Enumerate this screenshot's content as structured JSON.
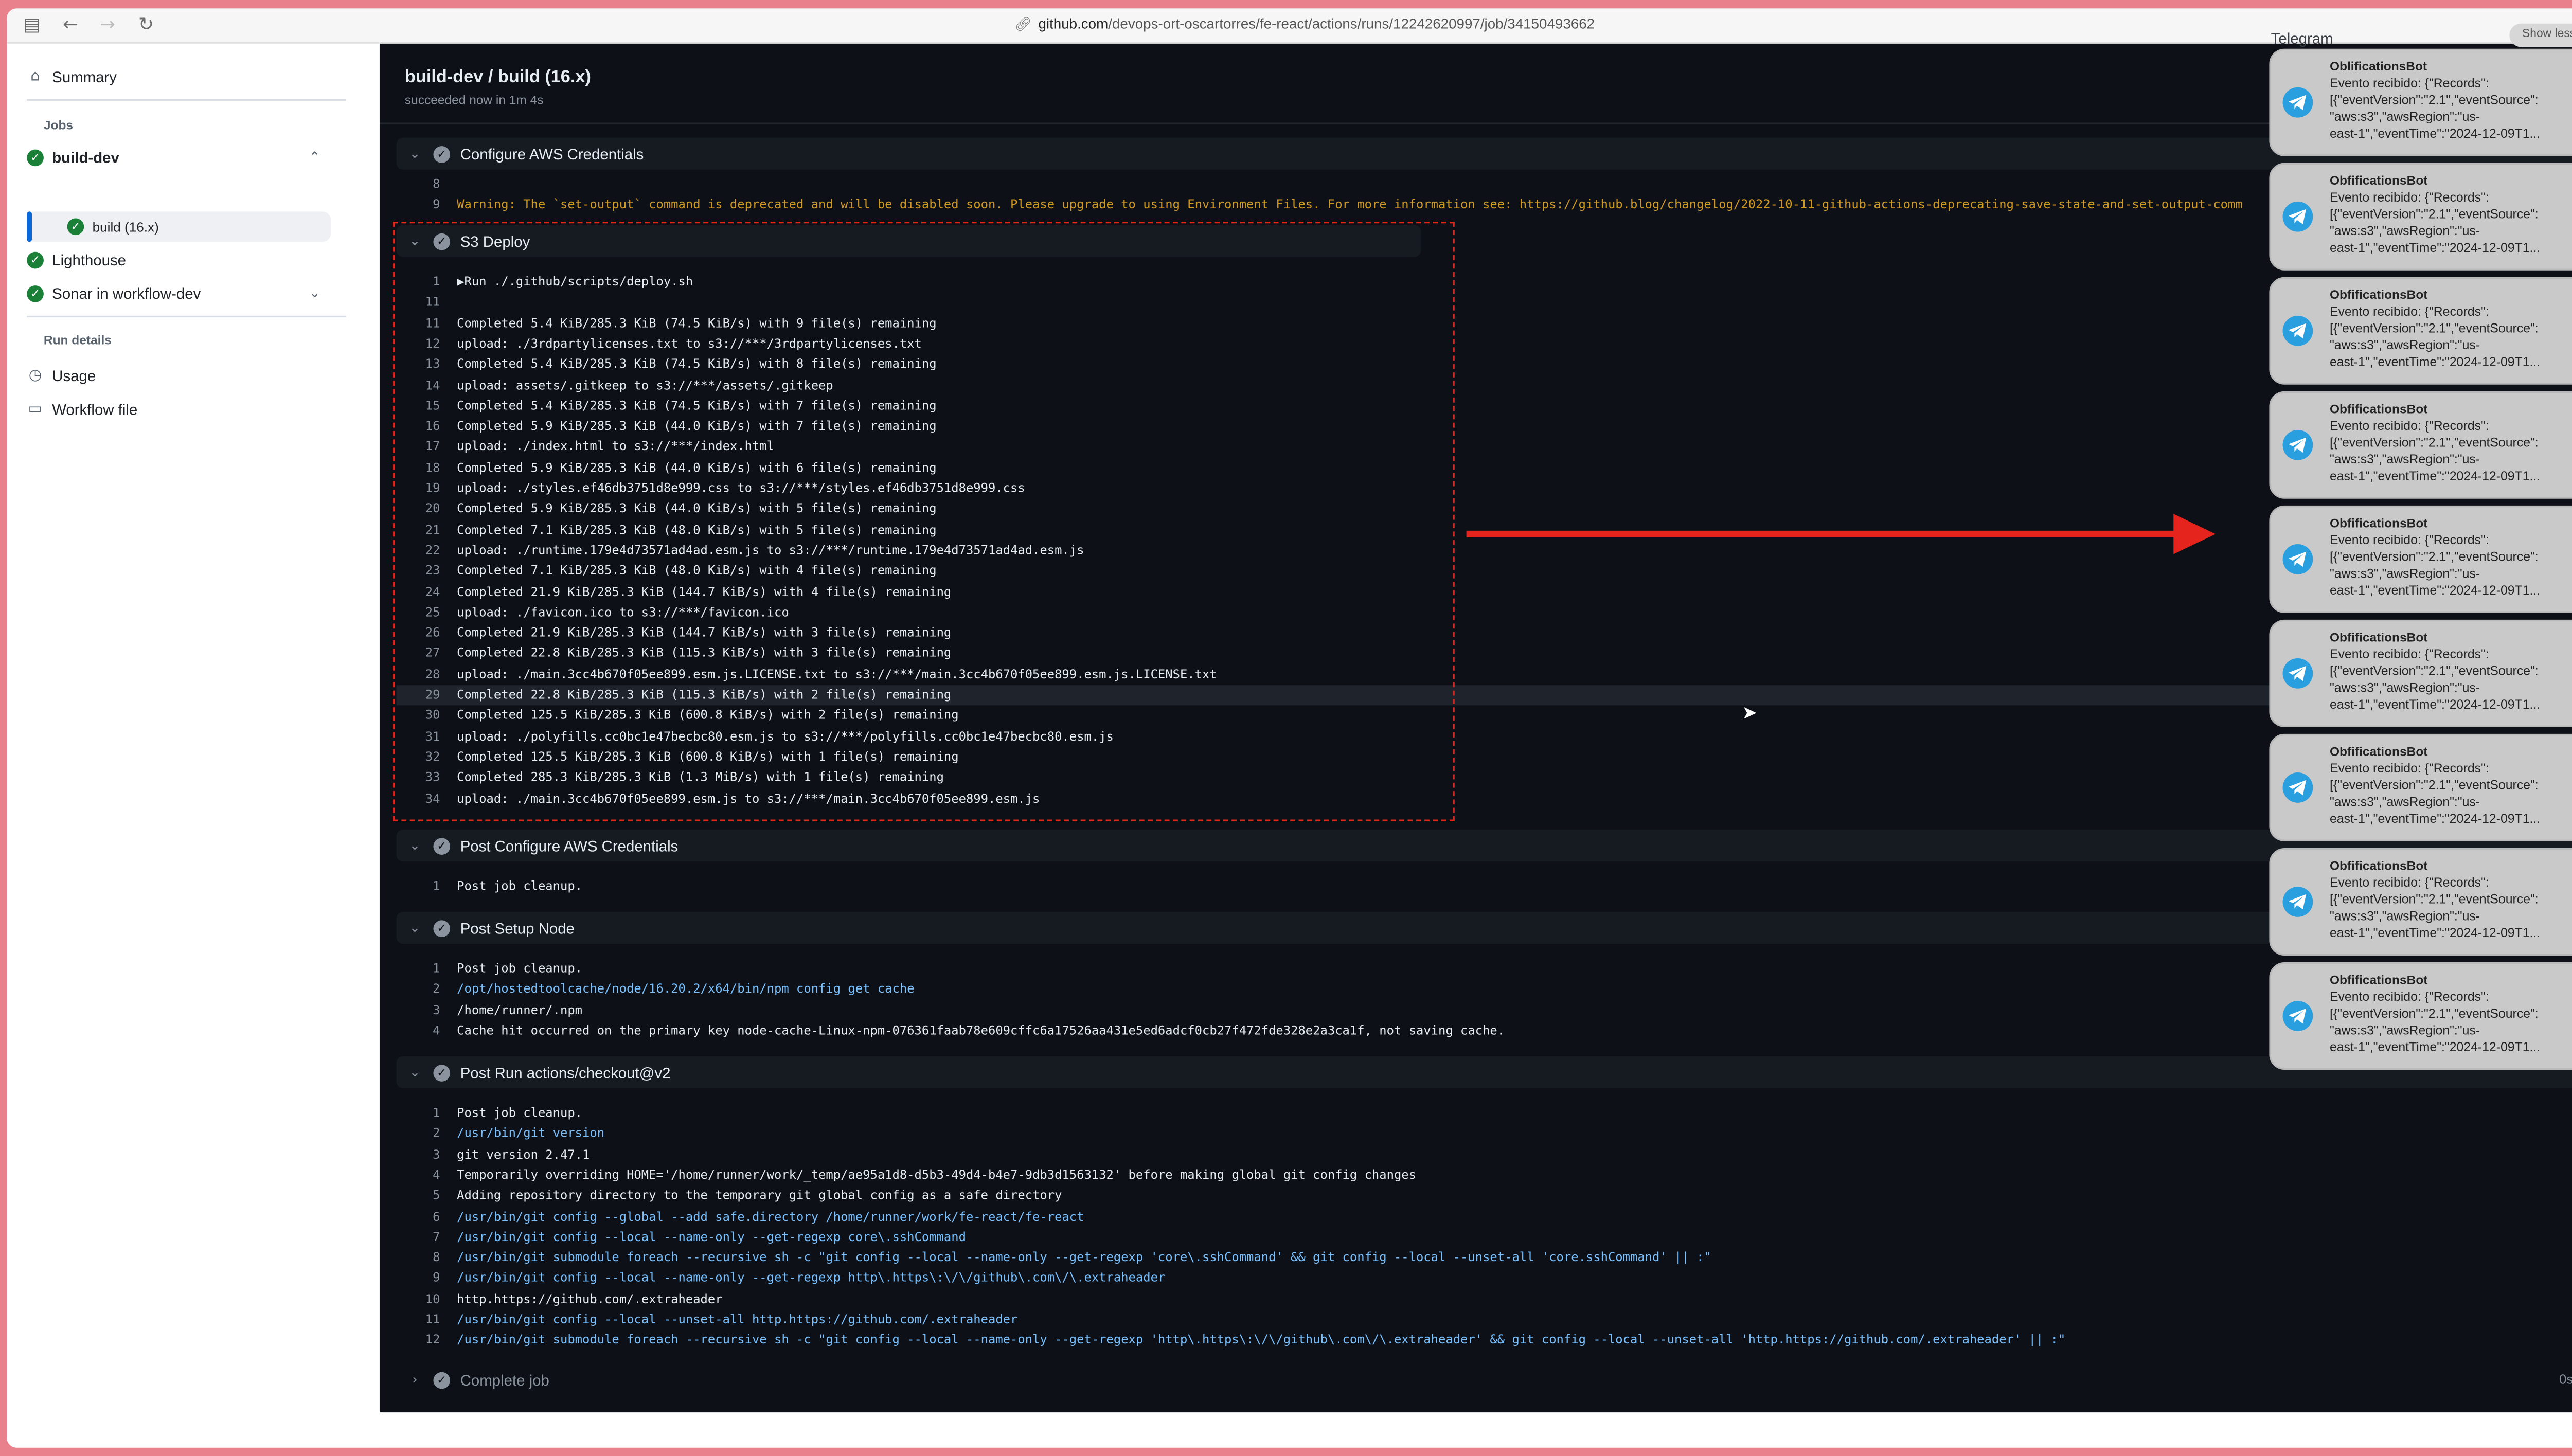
{
  "browser": {
    "url_domain": "github.com",
    "url_path": "/devops-ort-oscartorres/fe-react/actions/runs/12242620997/job/34150493662",
    "icons": [
      "sidebar-toggle-icon",
      "back-icon",
      "forward-icon",
      "reload-icon",
      "link-icon"
    ]
  },
  "sidebar": {
    "summary": "Summary",
    "jobs_heading": "Jobs",
    "jobs": [
      {
        "label": "build-dev"
      },
      {
        "label": "build (16.x)"
      },
      {
        "label": "Lighthouse"
      },
      {
        "label": "Sonar in workflow-dev"
      }
    ],
    "run_details_heading": "Run details",
    "usage": "Usage",
    "workflow_file": "Workflow file"
  },
  "header": {
    "title": "build-dev / build (16.x)",
    "subtitle": "succeeded now in 1m 4s"
  },
  "steps": {
    "configure_aws": "Configure AWS Credentials",
    "s3_deploy": "S3 Deploy",
    "post_configure_aws": "Post Configure AWS Credentials",
    "post_setup_node": "Post Setup Node",
    "post_checkout": "Post Run actions/checkout@v2",
    "complete_job": "Complete job",
    "complete_job_duration": "0s"
  },
  "logs": {
    "configure_aws": [
      {
        "n": "8",
        "t": ""
      },
      {
        "n": "9",
        "t": "Warning: The `set-output` command is deprecated and will be disabled soon. Please upgrade to using Environment Files. For more information see: https://github.blog/changelog/2022-10-11-github-actions-deprecating-save-state-and-set-output-comm"
      }
    ],
    "s3_deploy": [
      {
        "n": "1",
        "t": "▶Run ./.github/scripts/deploy.sh"
      },
      {
        "n": "11",
        "t": ""
      },
      {
        "n": "11",
        "t": "Completed 5.4 KiB/285.3 KiB (74.5 KiB/s) with 9 file(s) remaining"
      },
      {
        "n": "12",
        "t": "upload: ./3rdpartylicenses.txt to s3://***/3rdpartylicenses.txt"
      },
      {
        "n": "13",
        "t": "Completed 5.4 KiB/285.3 KiB (74.5 KiB/s) with 8 file(s) remaining"
      },
      {
        "n": "14",
        "t": "upload: assets/.gitkeep to s3://***/assets/.gitkeep"
      },
      {
        "n": "15",
        "t": "Completed 5.4 KiB/285.3 KiB (74.5 KiB/s) with 7 file(s) remaining"
      },
      {
        "n": "16",
        "t": "Completed 5.9 KiB/285.3 KiB (44.0 KiB/s) with 7 file(s) remaining"
      },
      {
        "n": "17",
        "t": "upload: ./index.html to s3://***/index.html"
      },
      {
        "n": "18",
        "t": "Completed 5.9 KiB/285.3 KiB (44.0 KiB/s) with 6 file(s) remaining"
      },
      {
        "n": "19",
        "t": "upload: ./styles.ef46db3751d8e999.css to s3://***/styles.ef46db3751d8e999.css"
      },
      {
        "n": "20",
        "t": "Completed 5.9 KiB/285.3 KiB (44.0 KiB/s) with 5 file(s) remaining"
      },
      {
        "n": "21",
        "t": "Completed 7.1 KiB/285.3 KiB (48.0 KiB/s) with 5 file(s) remaining"
      },
      {
        "n": "22",
        "t": "upload: ./runtime.179e4d73571ad4ad.esm.js to s3://***/runtime.179e4d73571ad4ad.esm.js"
      },
      {
        "n": "23",
        "t": "Completed 7.1 KiB/285.3 KiB (48.0 KiB/s) with 4 file(s) remaining"
      },
      {
        "n": "24",
        "t": "Completed 21.9 KiB/285.3 KiB (144.7 KiB/s) with 4 file(s) remaining"
      },
      {
        "n": "25",
        "t": "upload: ./favicon.ico to s3://***/favicon.ico"
      },
      {
        "n": "26",
        "t": "Completed 21.9 KiB/285.3 KiB (144.7 KiB/s) with 3 file(s) remaining"
      },
      {
        "n": "27",
        "t": "Completed 22.8 KiB/285.3 KiB (115.3 KiB/s) with 3 file(s) remaining"
      },
      {
        "n": "28",
        "t": "upload: ./main.3cc4b670f05ee899.esm.js.LICENSE.txt to s3://***/main.3cc4b670f05ee899.esm.js.LICENSE.txt"
      },
      {
        "n": "29",
        "t": "Completed 22.8 KiB/285.3 KiB (115.3 KiB/s) with 2 file(s) remaining"
      },
      {
        "n": "30",
        "t": "Completed 125.5 KiB/285.3 KiB (600.8 KiB/s) with 2 file(s) remaining"
      },
      {
        "n": "31",
        "t": "upload: ./polyfills.cc0bc1e47becbc80.esm.js to s3://***/polyfills.cc0bc1e47becbc80.esm.js"
      },
      {
        "n": "32",
        "t": "Completed 125.5 KiB/285.3 KiB (600.8 KiB/s) with 1 file(s) remaining"
      },
      {
        "n": "33",
        "t": "Completed 285.3 KiB/285.3 KiB (1.3 MiB/s) with 1 file(s) remaining"
      },
      {
        "n": "34",
        "t": "upload: ./main.3cc4b670f05ee899.esm.js to s3://***/main.3cc4b670f05ee899.esm.js"
      }
    ],
    "post_configure_aws": [
      {
        "n": "1",
        "t": "Post job cleanup."
      }
    ],
    "post_setup_node": [
      {
        "n": "1",
        "t": "Post job cleanup."
      },
      {
        "n": "2",
        "t": "/opt/hostedtoolcache/node/16.20.2/x64/bin/npm config get cache"
      },
      {
        "n": "3",
        "t": "/home/runner/.npm"
      },
      {
        "n": "4",
        "t": "Cache hit occurred on the primary key node-cache-Linux-npm-076361faab78e609cffc6a17526aa431e5ed6adcf0cb27f472fde328e2a3ca1f, not saving cache."
      }
    ],
    "post_checkout": [
      {
        "n": "1",
        "t": "Post job cleanup."
      },
      {
        "n": "2",
        "t": "/usr/bin/git version"
      },
      {
        "n": "3",
        "t": "git version 2.47.1"
      },
      {
        "n": "4",
        "t": "Temporarily overriding HOME='/home/runner/work/_temp/ae95a1d8-d5b3-49d4-b4e7-9db3d1563132' before making global git config changes"
      },
      {
        "n": "5",
        "t": "Adding repository directory to the temporary git global config as a safe directory"
      },
      {
        "n": "6",
        "t": "/usr/bin/git config --global --add safe.directory /home/runner/work/fe-react/fe-react"
      },
      {
        "n": "7",
        "t": "/usr/bin/git config --local --name-only --get-regexp core\\.sshCommand"
      },
      {
        "n": "8",
        "t": "/usr/bin/git submodule foreach --recursive sh -c \"git config --local --name-only --get-regexp 'core\\.sshCommand' && git config --local --unset-all 'core.sshCommand' || :\""
      },
      {
        "n": "9",
        "t": "/usr/bin/git config --local --name-only --get-regexp http\\.https\\:\\/\\/github\\.com\\/\\.extraheader"
      },
      {
        "n": "10",
        "t": "http.https://github.com/.extraheader"
      },
      {
        "n": "11",
        "t": "/usr/bin/git config --local --unset-all http.https://github.com/.extraheader"
      },
      {
        "n": "12",
        "t": "/usr/bin/git submodule foreach --recursive sh -c \"git config --local --name-only --get-regexp 'http\\.https\\:\\/\\/github\\.com\\/\\.extraheader' && git config --local --unset-all 'http.https://github.com/.extraheader' || :\""
      }
    ]
  },
  "notifications": {
    "app_title": "Telegram",
    "show_less": "Show less",
    "close": "×",
    "items": [
      {
        "sender": "OblificationsBot",
        "lines": [
          "Evento recibido: {\"Records\":",
          "[{\"eventVersion\":\"2.1\",\"eventSource\":",
          "\"aws:s3\",\"awsRegion\":\"us-",
          "east-1\",\"eventTime\":\"2024-12-09T1..."
        ],
        "avatar": "DO"
      },
      {
        "sender": "ObfificationsBot",
        "lines": [
          "Evento recibido: {\"Records\":",
          "[{\"eventVersion\":\"2.1\",\"eventSource\":",
          "\"aws:s3\",\"awsRegion\":\"us-",
          "east-1\",\"eventTime\":\"2024-12-09T1..."
        ],
        "avatar": "DO"
      },
      {
        "sender": "ObfificationsBot",
        "lines": [
          "Evento recibido: {\"Records\":",
          "[{\"eventVersion\":\"2.1\",\"eventSource\":",
          "\"aws:s3\",\"awsRegion\":\"us-",
          "east-1\",\"eventTime\":\"2024-12-09T1..."
        ],
        "avatar": "DO"
      },
      {
        "sender": "ObfificationsBot",
        "lines": [
          "Evento recibido: {\"Records\":",
          "[{\"eventVersion\":\"2.1\",\"eventSource\":",
          "\"aws:s3\",\"awsRegion\":\"us-",
          "east-1\",\"eventTime\":\"2024-12-09T1..."
        ],
        "avatar": "DO"
      },
      {
        "sender": "ObfificationsBot",
        "lines": [
          "Evento recibido: {\"Records\":",
          "[{\"eventVersion\":\"2.1\",\"eventSource\":",
          "\"aws:s3\",\"awsRegion\":\"us-",
          "east-1\",\"eventTime\":\"2024-12-09T1..."
        ],
        "avatar": "DO"
      },
      {
        "sender": "ObfificationsBot",
        "lines": [
          "Evento recibido: {\"Records\":",
          "[{\"eventVersion\":\"2.1\",\"eventSource\":",
          "\"aws:s3\",\"awsRegion\":\"us-",
          "east-1\",\"eventTime\":\"2024-12-09T1..."
        ],
        "avatar": "DO"
      },
      {
        "sender": "ObfificationsBot",
        "lines": [
          "Evento recibido: {\"Records\":",
          "[{\"eventVersion\":\"2.1\",\"eventSource\":",
          "\"aws:s3\",\"awsRegion\":\"us-",
          "east-1\",\"eventTime\":\"2024-12-09T1..."
        ],
        "avatar": "DO"
      },
      {
        "sender": "ObfificationsBot",
        "lines": [
          "Evento recibido: {\"Records\":",
          "[{\"eventVersion\":\"2.1\",\"eventSource\":",
          "\"aws:s3\",\"awsRegion\":\"us-",
          "east-1\",\"eventTime\":\"2024-12-09T1..."
        ],
        "avatar": "DO"
      },
      {
        "sender": "ObfificationsBot",
        "lines": [
          "Evento recibido: {\"Records\":",
          "[{\"eventVersion\":\"2.1\",\"eventSource\":",
          "\"aws:s3\",\"awsRegion\":\"us-",
          "east-1\",\"eventTime\":\"2024-12-09T1..."
        ],
        "avatar": "DO"
      }
    ]
  },
  "colors": {
    "background": "#e8818c",
    "log_bg": "#0d1117",
    "annotation_red": "#e5251d",
    "success_green": "#1a7f37",
    "telegram_blue": "#2a9fe0"
  }
}
